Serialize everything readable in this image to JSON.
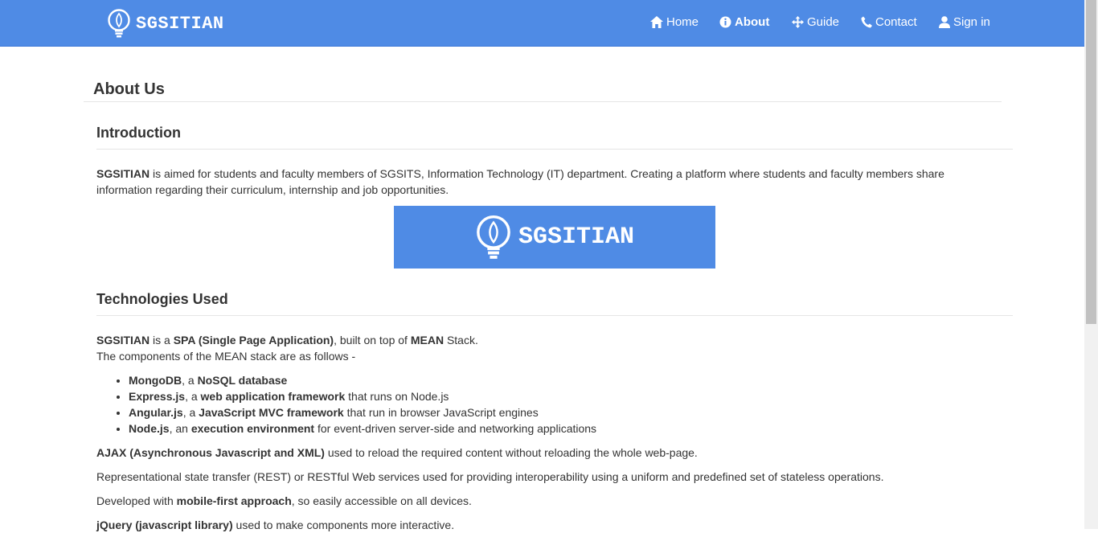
{
  "brand": {
    "name": "SGSITIAN"
  },
  "nav": {
    "items": [
      {
        "label": "Home",
        "icon": "home-icon"
      },
      {
        "label": "About",
        "icon": "info-icon",
        "active": true
      },
      {
        "label": "Guide",
        "icon": "move-icon"
      },
      {
        "label": "Contact",
        "icon": "phone-icon"
      },
      {
        "label": "Sign in",
        "icon": "user-icon"
      }
    ]
  },
  "page": {
    "title": "About Us"
  },
  "introduction": {
    "heading": "Introduction",
    "lead_bold": "SGSITIAN",
    "text_line1": " is aimed for students and faculty members of SGSITS, Information Technology (IT) department. Creating a platform where students and faculty members share",
    "text_line2": "information regarding their curriculum, internship and job opportunities.",
    "banner_text": "SGSITIAN"
  },
  "technologies": {
    "heading": "Technologies Used",
    "p1": {
      "b1": "SGSITIAN",
      "t1": " is a ",
      "b2": "SPA (Single Page Application)",
      "t2": ", built on top of ",
      "b3": "MEAN",
      "t3": " Stack."
    },
    "p1_line2": "The components of the MEAN stack are as follows -",
    "stack": [
      {
        "name": "MongoDB",
        "sep": ", a ",
        "desc_bold": "NoSQL database",
        "desc": ""
      },
      {
        "name": "Express.js",
        "sep": ", a ",
        "desc_bold": "web application framework",
        "desc": " that runs on Node.js"
      },
      {
        "name": "Angular.js",
        "sep": ", a ",
        "desc_bold": "JavaScript MVC framework",
        "desc": " that run in browser JavaScript engines"
      },
      {
        "name": "Node.js",
        "sep": ", an ",
        "desc_bold": "execution environment",
        "desc": " for event-driven server-side and networking applications"
      }
    ],
    "ajax": {
      "bold": "AJAX (Asynchronous Javascript and XML)",
      "text": " used to reload the required content without reloading the whole web-page."
    },
    "rest": "Representational state transfer (REST) or RESTful Web services used for providing interoperability using a uniform and predefined set of stateless operations.",
    "mobile": {
      "t1": "Developed with ",
      "bold": "mobile-first approach",
      "t2": ", so easily accessible on all devices."
    },
    "jquery": {
      "bold": "jQuery (javascript library)",
      "text": " used to make components more interactive."
    }
  },
  "colors": {
    "navbar": "#4f8be5",
    "text": "#333333",
    "divider": "#e5e5e5"
  }
}
